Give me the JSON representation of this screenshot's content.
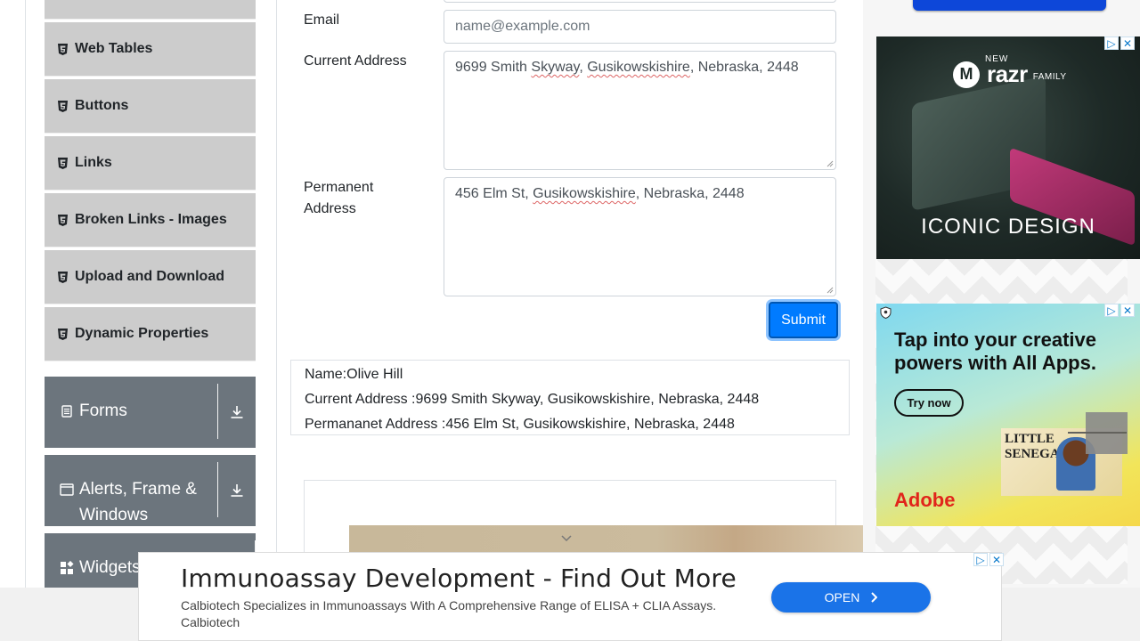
{
  "sidebar": {
    "elements_items": [
      {
        "label": "Web Tables"
      },
      {
        "label": "Buttons"
      },
      {
        "label": "Links"
      },
      {
        "label": "Broken Links - Images"
      },
      {
        "label": "Upload and Download"
      },
      {
        "label": "Dynamic Properties"
      }
    ],
    "groups": [
      {
        "label": "Forms"
      },
      {
        "label": "Alerts, Frame & Windows"
      },
      {
        "label": "Widgets"
      }
    ]
  },
  "form": {
    "email_label": "Email",
    "email_placeholder": "name@example.com",
    "current_address_label": "Current Address",
    "current_address_parts": [
      "9699 Smith ",
      "Skyway",
      ", ",
      "Gusikowskishire",
      ", Nebraska, 2448"
    ],
    "permanent_address_label": "Permanent Address",
    "permanent_address_parts": [
      "456 Elm St, ",
      "Gusikowskishire",
      ", Nebraska, 2448"
    ],
    "submit_label": "Submit"
  },
  "output": {
    "name": "Name:Olive Hill",
    "current_address": "Current Address :9699 Smith Skyway, Gusikowskishire, Nebraska, 2448",
    "permanent_address": "Permananet Address :456 Elm St, Gusikowskishire, Nebraska, 2448"
  },
  "ads": {
    "motorola": {
      "new_label": "NEW",
      "product": "razr",
      "family": "FAMILY",
      "tagline": "ICONIC DESIGN"
    },
    "adobe": {
      "headline": "Tap into your creative powers with All Apps.",
      "cta": "Try now",
      "poster_text": "LITTLE SENEGAL",
      "brand": "Adobe",
      "brand_color": "#e1251b"
    },
    "banner": {
      "headline": "Immunoassay Development - Find Out More",
      "description": "Calbiotech Specializes in Immunoassays With A Comprehensive Range of ELISA + CLIA Assays.",
      "source": "Calbiotech",
      "cta": "OPEN"
    },
    "close_glyphs": [
      "▷",
      "✕"
    ]
  },
  "colors": {
    "primary": "#007bff",
    "sidebar_item": "#cccccc",
    "group_bg": "#6c757d"
  }
}
